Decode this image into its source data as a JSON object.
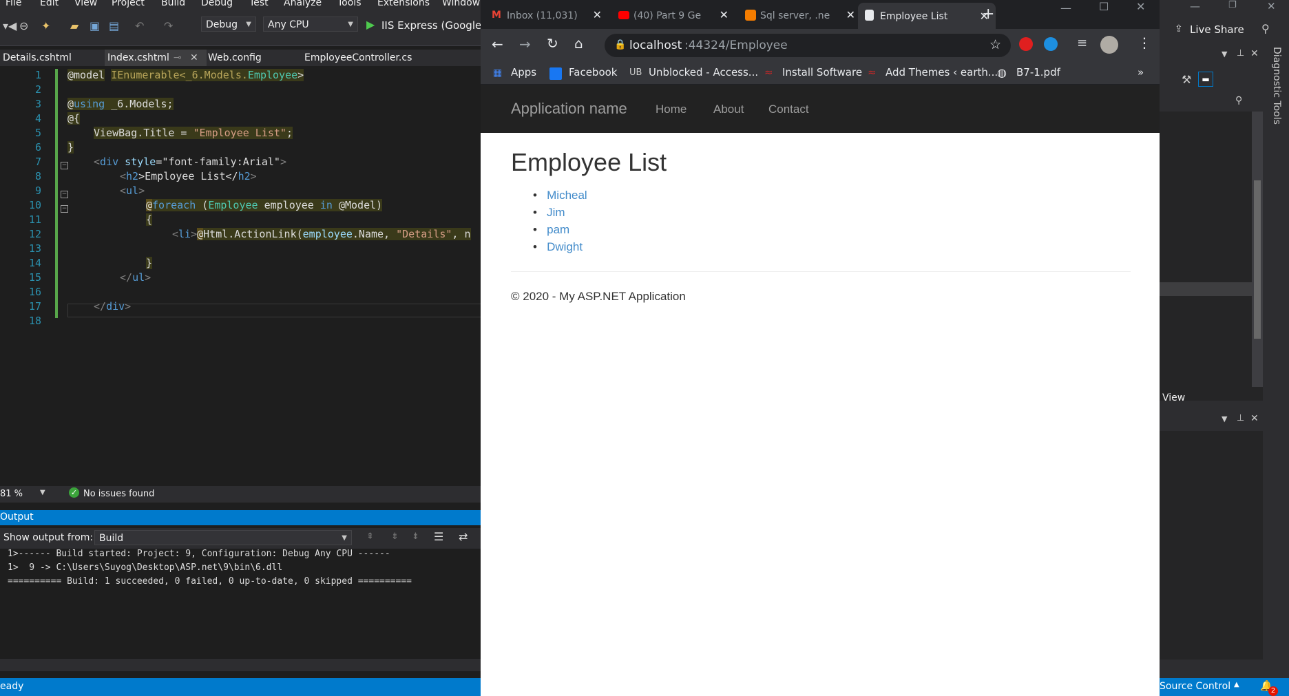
{
  "vs": {
    "menu": [
      "File",
      "Edit",
      "View",
      "Project",
      "Build",
      "Debug",
      "Test",
      "Analyze",
      "Tools",
      "Extensions",
      "Window"
    ],
    "toolbar": {
      "config": "Debug",
      "platform": "Any CPU",
      "run_label": "IIS Express (Google Chrome)"
    },
    "tabs": [
      "Details.cshtml",
      "Index.cshtml",
      "Web.config",
      "EmployeeController.cs"
    ],
    "active_tab": "Index.cshtml",
    "line_numbers": [
      "1",
      "2",
      "3",
      "4",
      "5",
      "6",
      "7",
      "8",
      "9",
      "10",
      "11",
      "12",
      "13",
      "14",
      "15",
      "16",
      "17",
      "18"
    ],
    "code": {
      "l1a": "@model",
      "l1b": "IEnumerable<_6.Models.",
      "l1c": "Employee",
      "l1d": ">",
      "l3a": "@",
      "l3b": "using",
      "l3c": " _6.Models;",
      "l4": "@{",
      "l5a": "ViewBag.Title = ",
      "l5b": "\"Employee List\"",
      "l5c": ";",
      "l6": "}",
      "l7a": "<",
      "l7b": "div",
      "l7c": " style",
      "l7d": "=\"font-family:Arial\"",
      "l7e": ">",
      "l8a": "<",
      "l8b": "h2",
      "l8c": ">Employee List</",
      "l8d": "h2",
      "l8e": ">",
      "l9a": "<",
      "l9b": "ul",
      "l9c": ">",
      "l10a": "@",
      "l10b": "foreach",
      "l10c": " (",
      "l10d": "Employee",
      "l10e": " employee ",
      "l10f": "in",
      "l10g": " @Model)",
      "l11": "{",
      "l12a": "<",
      "l12b": "li",
      "l12c": ">",
      "l12d": "@",
      "l12e": "Html.ActionLink(",
      "l12f": "employee",
      "l12g": ".Name, ",
      "l12h": "\"Details\"",
      "l12i": ", n",
      "l14": "}",
      "l15a": "</",
      "l15b": "ul",
      "l15c": ">",
      "l17a": "</",
      "l17b": "div",
      "l17c": ">"
    },
    "zoom": "81 %",
    "issues": "No issues found",
    "output": {
      "title": "Output",
      "show_from_label": "Show output from:",
      "source": "Build",
      "lines": [
        "1>------ Build started: Project: 9, Configuration: Debug Any CPU ------",
        "1>  9 -> C:\\Users\\Suyog\\Desktop\\ASP.net\\9\\bin\\6.dll",
        "========== Build: 1 succeeded, 0 failed, 0 up-to-date, 0 skipped =========="
      ]
    },
    "status": "eady",
    "right": {
      "live_share": "Live Share",
      "diagnostic": "Diagnostic Tools",
      "view": "View",
      "source_control": "Source Control",
      "notif_count": "2"
    }
  },
  "chrome": {
    "tabs": [
      {
        "title": "Inbox (11,031)",
        "icon": "gmail-icon",
        "color": "#ea4335"
      },
      {
        "title": "(40) Part 9 Ge",
        "icon": "youtube-icon",
        "color": "#ff0000"
      },
      {
        "title": "Sql server, .ne",
        "icon": "blogger-icon",
        "color": "#f57d00"
      },
      {
        "title": "Employee List",
        "icon": "page-icon",
        "color": "#e8eaed"
      }
    ],
    "url_host": "localhost",
    "url_path": ":44324/Employee",
    "bookmarks": [
      "Apps",
      "Facebook",
      "Unblocked - Access...",
      "Install Software",
      "Add Themes ‹ earth...",
      "B7-1.pdf"
    ],
    "overflow": "»"
  },
  "site": {
    "brand": "Application name",
    "nav": [
      "Home",
      "About",
      "Contact"
    ],
    "heading": "Employee List",
    "employees": [
      "Micheal",
      "Jim",
      "pam",
      "Dwight"
    ],
    "footer": "© 2020 - My ASP.NET Application",
    "link_color": "#428bca"
  }
}
